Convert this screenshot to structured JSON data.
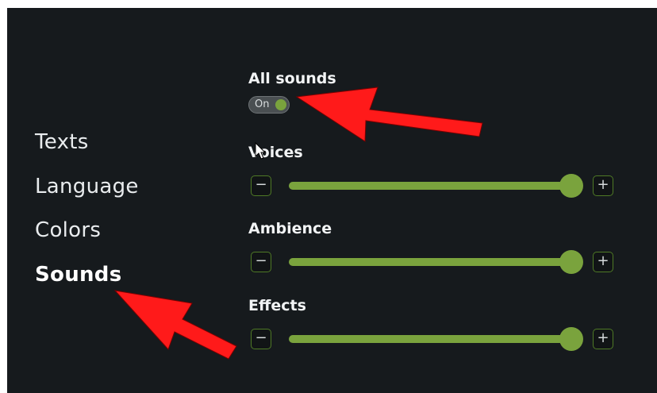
{
  "nav": {
    "items": [
      {
        "label": "Texts"
      },
      {
        "label": "Language"
      },
      {
        "label": "Colors"
      },
      {
        "label": "Sounds",
        "active": true
      }
    ]
  },
  "all_sounds": {
    "title": "All sounds",
    "state": "On"
  },
  "sliders": [
    {
      "title": "Voices",
      "value": 1.0,
      "minus": "−",
      "plus": "+"
    },
    {
      "title": "Ambience",
      "value": 1.0,
      "minus": "−",
      "plus": "+"
    },
    {
      "title": "Effects",
      "value": 1.0,
      "minus": "−",
      "plus": "+"
    }
  ],
  "colors": {
    "accent": "#7aa33d",
    "background": "#161a1d",
    "annotation_arrow": "#ff1a1a"
  },
  "icons": {
    "cursor": "mouse-pointer-icon",
    "annotation": "red-arrow-icon"
  }
}
